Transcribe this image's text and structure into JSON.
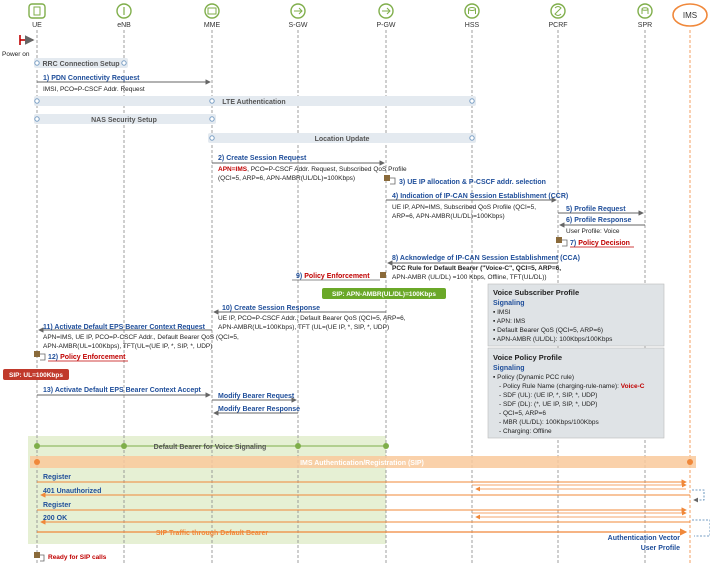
{
  "actors": [
    {
      "name": "UE",
      "icon": "ue-icon",
      "color": "#7fae4a"
    },
    {
      "name": "eNB",
      "icon": "enb-icon",
      "color": "#7fae4a"
    },
    {
      "name": "MME",
      "icon": "mme-icon",
      "color": "#7fae4a"
    },
    {
      "name": "S-GW",
      "icon": "sgw-icon",
      "color": "#7fae4a"
    },
    {
      "name": "P-GW",
      "icon": "pgw-icon",
      "color": "#7fae4a"
    },
    {
      "name": "HSS",
      "icon": "hss-icon",
      "color": "#7fae4a"
    },
    {
      "name": "PCRF",
      "icon": "pcrf-icon",
      "color": "#7fae4a"
    },
    {
      "name": "SPR",
      "icon": "spr-icon",
      "color": "#7fae4a"
    },
    {
      "name": "IMS",
      "icon": "ims-icon",
      "color": "#f0883a"
    }
  ],
  "power_on": "Power on",
  "bars": {
    "rrc": "RRC Connection Setup",
    "lte_auth": "LTE Authentication",
    "nas": "NAS Security Setup",
    "location": "Location Update",
    "default_bearer": "Default Bearer for Voice Signaling",
    "ims_auth": "IMS Authentication/Registration (SIP)",
    "sip_traffic": "SIP Traffic through Default Bearer"
  },
  "messages": {
    "m1": {
      "num": "1)",
      "label": "PDN Connectivity Request",
      "detail": "IMSI, PCO=P-CSCF Addr. Request"
    },
    "m2": {
      "num": "2)",
      "label": "Create Session Request",
      "detail1_red": "APN=IMS",
      "detail1": ", PCO=P-CSCF Addr. Request, Subscribed QoS Profile",
      "detail2": "(QCI=5, ARP=6, APN-AMBR(UL/DL)=100Kbps)"
    },
    "m3": {
      "num": "3)",
      "label": "UE IP allocation & P-CSCF addr. selection"
    },
    "m4": {
      "num": "4)",
      "label": "Indication of IP-CAN Session Establishment (CCR)",
      "detail1": "UE IP, APN=IMS, Subscribed QoS Profile (QCI=5,",
      "detail2": "ARP=6, APN-AMBR(UL/DL)=100Kbps)"
    },
    "m5": {
      "num": "5)",
      "label": "Profile Request"
    },
    "m6": {
      "num": "6)",
      "label": "Profile Response",
      "detail": "User Profile: Voice"
    },
    "m7": {
      "num": "7)",
      "label": "Policy Decision"
    },
    "m8": {
      "num": "8)",
      "label": "Acknowledge of IP-CAN Session Establishment (CCA)",
      "detail1": "PCC Rule for Default Bearer (\"Voice-C\", QCI=5, ARP=6,",
      "detail2": "APN-AMBR (UL/DL) =100 Kbps, Offline, TFT(UL/DL))"
    },
    "m9": {
      "num": "9)",
      "label": "Policy Enforcement"
    },
    "m10": {
      "num": "10)",
      "label": "Create Session Response",
      "detail1": "UE IP, PCO=P-CSCF Addr., Default Bearer QoS (QCI=5, ARP=6,",
      "detail2": "APN-AMBR(UL=100Kbps), TFT (UL=(UE IP, *, SIP, *, UDP)"
    },
    "m11": {
      "num": "11)",
      "label": "Activate Default EPS Bearer Context Request",
      "detail1": "APN=IMS, UE IP, PCO=P-CSCF Addr., Default Bearer QoS (QCI=5,",
      "detail2": "APN-AMBR(UL=100Kbps), TFT(UL=(UE IP, *, SIP, *, UDP)"
    },
    "m12": {
      "num": "12)",
      "label": "Policy Enforcement"
    },
    "m13": {
      "num": "13)",
      "label": "Activate Default EPS Bearer Context Accept"
    },
    "modify_req": "Modify Bearer Request",
    "modify_resp": "Modify Bearer Response",
    "register1": "Register",
    "unauth": "401 Unauthorized",
    "register2": "Register",
    "ok": "200 OK",
    "auth_vector": "Authentication Vector",
    "user_profile": "User Profile",
    "ready": "Ready for SIP calls"
  },
  "badges": {
    "pgw_sip": "SIP: APN-AMBR(UL/DL)=100Kbps",
    "ue_sip": "SIP: UL=100Kbps"
  },
  "voice_subscriber_profile": {
    "title": "Voice Subscriber Profile",
    "subtitle": "Signaling",
    "lines": [
      "IMSI",
      "APN: IMS",
      "Default Bearer QoS (QCI=5, ARP=6)",
      "APN-AMBR (UL/DL): 100Kbps/100Kbps"
    ]
  },
  "voice_policy_profile": {
    "title": "Voice Policy Profile",
    "subtitle": "Signaling",
    "policy": "Policy (Dynamic PCC rule)",
    "rule_prefix": "- Policy Rule Name (charging-rule-name): ",
    "rule_name": "Voice-C",
    "lines": [
      "- SDF (UL): (UE IP, *, SIP, *, UDP)",
      "- SDF (DL): (*, UE IP, SIP, *, UDP)",
      "- QCI=5, ARP=6",
      "- MBR (UL/DL): 100Kbps/100Kbps",
      "- Charging: Offline"
    ]
  },
  "colors": {
    "msg_blue": "#1f4e9a",
    "red": "#c00000",
    "green": "#7fae4a",
    "orange": "#f0883a",
    "bar_fill": "#e4eaf0",
    "green_zone": "#e6f0d4",
    "badge_green": "#6aa828",
    "badge_red": "#c0392b"
  }
}
